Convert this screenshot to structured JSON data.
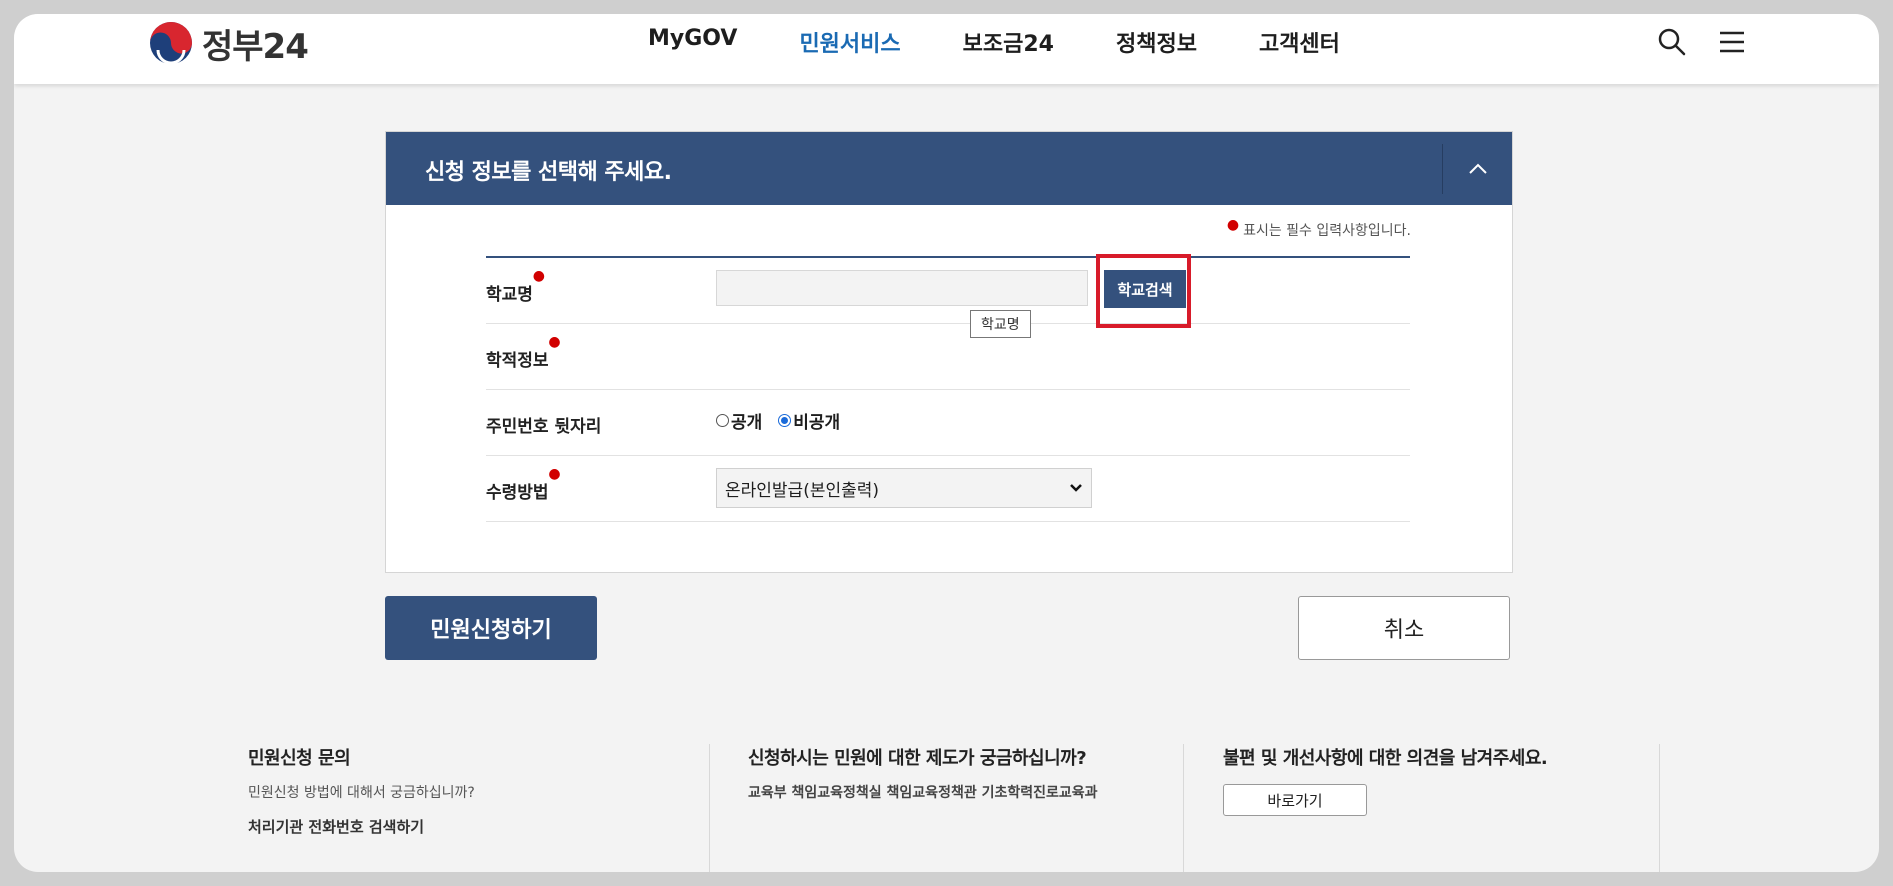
{
  "header": {
    "logo_text": "정부24",
    "nav": [
      "MyGOV",
      "민원서비스",
      "보조금24",
      "정책정보",
      "고객센터"
    ],
    "active_nav": "민원서비스"
  },
  "panel": {
    "title": "신청 정보를 선택해 주세요.",
    "required_note": "표시는 필수 입력사항입니다.",
    "fields": {
      "school": {
        "label": "학교명",
        "input_value": "",
        "button": "학교검색",
        "tooltip": "학교명"
      },
      "record": {
        "label": "학적정보"
      },
      "rrn": {
        "label": "주민번호 뒷자리",
        "options": [
          "공개",
          "비공개"
        ],
        "selected": "비공개"
      },
      "receive": {
        "label": "수령방법",
        "selected": "온라인발급(본인출력)"
      }
    }
  },
  "actions": {
    "submit": "민원신청하기",
    "cancel": "취소"
  },
  "info": {
    "col1": {
      "title": "민원신청 문의",
      "sub": "민원신청 방법에 대해서 궁금하십니까?",
      "link": "처리기관 전화번호 검색하기"
    },
    "col2": {
      "title": "신청하시는 민원에 대한 제도가 궁금하십니까?",
      "sub": "교육부 책임교육정책실 책임교육정책관 기초학력진로교육과"
    },
    "col3": {
      "title": "불편 및 개선사항에 대한 의견을 남겨주세요.",
      "button": "바로가기"
    }
  },
  "colors": {
    "primary": "#34517d",
    "accent": "#1a6ab3",
    "required": "#d10000",
    "highlight": "#d81b2a"
  }
}
